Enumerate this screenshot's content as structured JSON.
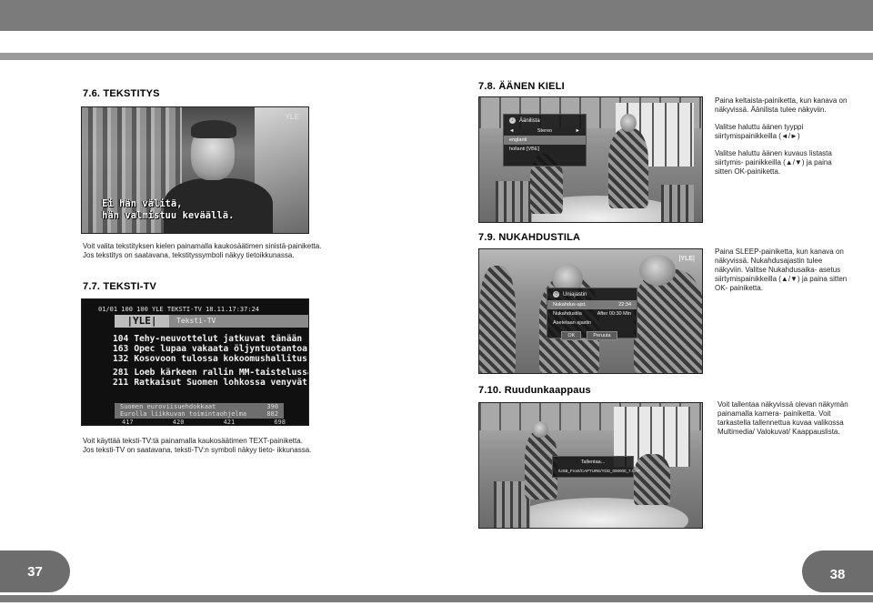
{
  "page_numbers": {
    "left": "37",
    "right": "38"
  },
  "section_7_6": {
    "heading": "7.6. TEKSTITYS",
    "screenshot": {
      "subtitle_line1": "Ei hän välitä,",
      "subtitle_line2": "hän valmistuu keväällä.",
      "channel_logo": "YLE"
    },
    "body_line1": "Voit valita tekstityksen kielen painamalla kaukosäätimen sinistä-painiketta.",
    "body_line2": "Jos tekstitys on saatavana, tekstityssymboli näkyy tietoikkunassa."
  },
  "section_7_7": {
    "heading": "7.7. TEKSTI-TV",
    "teletext": {
      "header": "01/01  100  100  YLE TEKSTI-TV  18.11.17:37:24",
      "logo": "|YLE|",
      "band": "Teksti-TV",
      "rows": [
        {
          "num": "104",
          "text": "Tehy-neuvottelut jatkuvat tänään"
        },
        {
          "num": "163",
          "text": "Opec lupaa vakaata öljyntuotantoa"
        },
        {
          "num": "132",
          "text": "Kosovoon tulossa kokoomushallitus?"
        },
        {
          "num": "281",
          "text": "Loeb kärkeen rallin MM-taistelussa"
        },
        {
          "num": "211",
          "text": "Ratkaisut Suomen lohkossa venyvät?"
        }
      ],
      "footer1_text": "Suomen euroviisuehdokkaat",
      "footer1_num": "390",
      "footer2_text": "Eurolla liikkuvan toimintaohjelma",
      "footer2_num": "882",
      "bottom_nums": [
        "417",
        "420",
        "421",
        "698"
      ]
    },
    "body_line1": "Voit käyttää teksti-TV:tä painamalla kaukosäätimen TEXT-painiketta.",
    "body_line2": "Jos teksti-TV on saatavana, teksti-TV:n symboli näkyy tieto- ikkunassa."
  },
  "section_7_8": {
    "heading": "7.8. ÄÄNEN KIELI",
    "osd": {
      "title": "Äänilista",
      "item1": "Stereo",
      "item2": "englanti",
      "item3": "hollanti [VBE]"
    },
    "instructions": [
      "Paina keltaista-painiketta, kun kanava on näkyvissä. Äänilista tulee näkyviin.",
      "Valitse haluttu äänen tyyppi siirtymispainikkeilla (◄/►)",
      "Valitse haluttu äänen kuvaus listasta siirtymis- painikkeilla (▲/▼) ja paina sitten OK-painiketta."
    ]
  },
  "section_7_9": {
    "heading": "7.9. NUKAHDUSTILA",
    "osd": {
      "title": "Uniajastin",
      "row1_label": "Nukahdus-ajst.",
      "row1_value": "22:34",
      "row2_label": "Nukahdustila",
      "row2_value": "After 00:30 Min",
      "row3_label": "Asetetaan ajastin",
      "ok": "OK",
      "cancel": "Peruuta"
    },
    "channel_logo": "|YLE|",
    "instructions": "Paina SLEEP-painiketta, kun kanava on näkyvissä. Nukahdusajastin tulee näkyviin. Valitse Nukahdusaika- asetus siirtymispainikkeilla (▲/▼) ja paina sitten OK- painiketta."
  },
  "section_7_10": {
    "heading": "7.10. Ruudunkaappaus",
    "osd": {
      "line1": "Tallentaa...",
      "line2": "/USB_Front/CAPTURE/YDD_000000_7.CAP"
    },
    "instructions": "Voit tallentaa näkyvissä olevan näkymän painamalla kamera- painiketta. Voit tarkastella tallennettua kuvaa valikossa Multimedia/ Valokuvat/ Kaappauslista."
  }
}
